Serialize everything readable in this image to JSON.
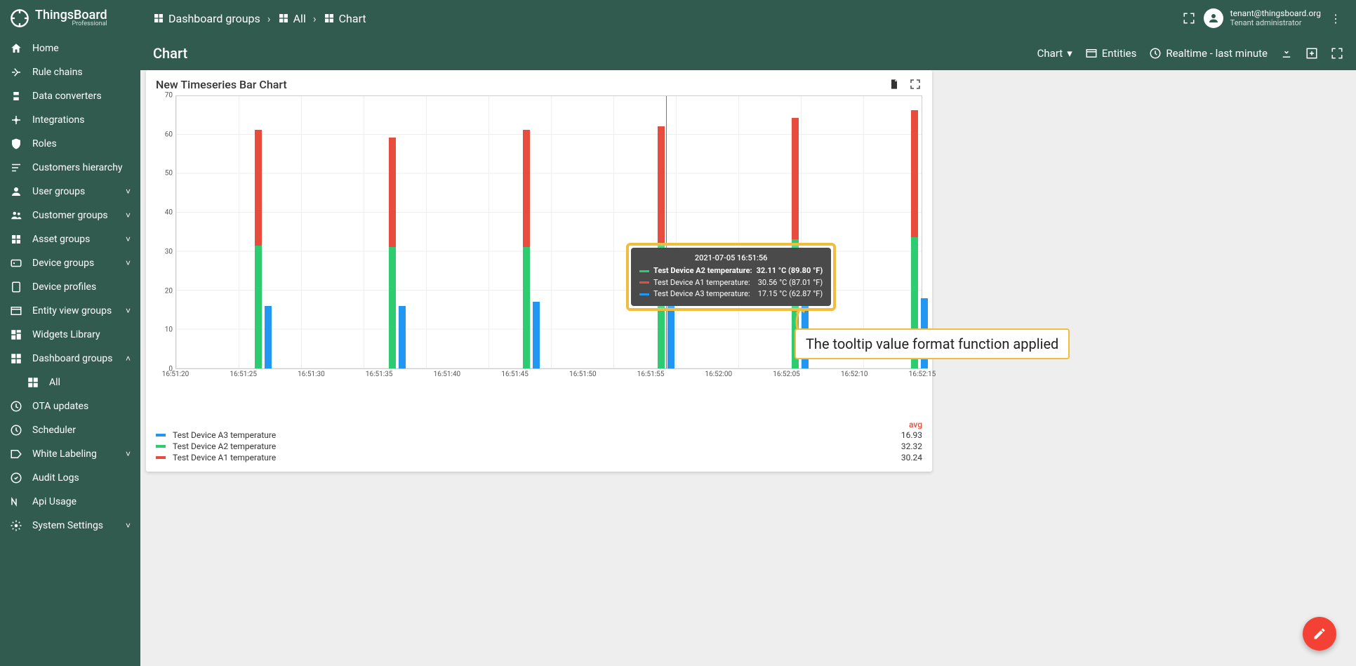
{
  "brand": {
    "name": "ThingsBoard",
    "edition": "Professional"
  },
  "user": {
    "email": "tenant@thingsboard.org",
    "role": "Tenant administrator"
  },
  "breadcrumbs": [
    {
      "label": "Dashboard groups"
    },
    {
      "label": "All"
    },
    {
      "label": "Chart"
    }
  ],
  "sidebar": [
    {
      "icon": "home",
      "label": "Home"
    },
    {
      "icon": "rules",
      "label": "Rule chains"
    },
    {
      "icon": "convert",
      "label": "Data converters"
    },
    {
      "icon": "integr",
      "label": "Integrations"
    },
    {
      "icon": "shield",
      "label": "Roles"
    },
    {
      "icon": "hier",
      "label": "Customers hierarchy"
    },
    {
      "icon": "user",
      "label": "User groups",
      "expand": "down"
    },
    {
      "icon": "cust",
      "label": "Customer groups",
      "expand": "down"
    },
    {
      "icon": "asset",
      "label": "Asset groups",
      "expand": "down"
    },
    {
      "icon": "device",
      "label": "Device groups",
      "expand": "down"
    },
    {
      "icon": "profile",
      "label": "Device profiles"
    },
    {
      "icon": "entity",
      "label": "Entity view groups",
      "expand": "down"
    },
    {
      "icon": "widget",
      "label": "Widgets Library"
    },
    {
      "icon": "dash",
      "label": "Dashboard groups",
      "expand": "up"
    },
    {
      "icon": "dash",
      "label": "All",
      "sub": true
    },
    {
      "icon": "ota",
      "label": "OTA updates"
    },
    {
      "icon": "sched",
      "label": "Scheduler"
    },
    {
      "icon": "label",
      "label": "White Labeling",
      "expand": "down"
    },
    {
      "icon": "audit",
      "label": "Audit Logs"
    },
    {
      "icon": "api",
      "label": "Api Usage"
    },
    {
      "icon": "settings",
      "label": "System Settings",
      "expand": "down"
    }
  ],
  "subbar": {
    "title": "Chart",
    "dashboard_dropdown": "Chart",
    "entities": "Entities",
    "time": "Realtime - last minute"
  },
  "card": {
    "title": "New Timeseries Bar Chart"
  },
  "colors": {
    "a1": "#E74C3C",
    "a2": "#2ECC71",
    "a3": "#2196F3",
    "highlight": "#F0BE3C"
  },
  "chart_data": {
    "type": "bar",
    "title": "New Timeseries Bar Chart",
    "ylim": [
      0,
      70
    ],
    "yticks": [
      0,
      10,
      20,
      30,
      40,
      50,
      60,
      70
    ],
    "x_ticks": [
      "16:51:20",
      "16:51:25",
      "16:51:30",
      "16:51:35",
      "16:51:40",
      "16:51:45",
      "16:51:50",
      "16:51:55",
      "16:52:00",
      "16:52:05",
      "16:52:10",
      "16:52:15"
    ],
    "categories": [
      "16:51:26",
      "16:51:36",
      "16:51:46",
      "16:51:56",
      "16:52:06",
      "16:52:16"
    ],
    "groups": [
      {
        "a1_top": 61,
        "a2_top": 31.5,
        "a3": 16,
        "xfrac": 0.115
      },
      {
        "a1_top": 59,
        "a2_top": 31,
        "a3": 16,
        "xfrac": 0.295
      },
      {
        "a1_top": 61,
        "a2_top": 31,
        "a3": 17,
        "xfrac": 0.475
      },
      {
        "a1_top": 62,
        "a2_top": 32.11,
        "a3": 16,
        "xfrac": 0.655
      },
      {
        "a1_top": 64,
        "a2_top": 33,
        "a3": 17,
        "xfrac": 0.835
      },
      {
        "a1_top": 66,
        "a2_top": 33.5,
        "a3": 18,
        "xfrac": 0.995
      }
    ],
    "crosshair_xfrac": 0.657,
    "series": [
      {
        "name": "Test Device A3 temperature",
        "color": "#2196F3",
        "avg": "16.93"
      },
      {
        "name": "Test Device A2 temperature",
        "color": "#2ECC71",
        "avg": "32.32"
      },
      {
        "name": "Test Device A1 temperature",
        "color": "#E74C3C",
        "avg": "30.24"
      }
    ],
    "avg_header": "avg"
  },
  "tooltip": {
    "time": "2021-07-05 16:51:56",
    "rows": [
      {
        "color": "#2ECC71",
        "label": "Test Device A2 temperature:",
        "value": "32.11 °C (89.80 °F)",
        "bold": true
      },
      {
        "color": "#E74C3C",
        "label": "Test Device A1 temperature:",
        "value": "30.56 °C (87.01 °F)"
      },
      {
        "color": "#2196F3",
        "label": "Test Device A3 temperature:",
        "value": "17.15 °C (62.87 °F)"
      }
    ]
  },
  "annotation": "The tooltip value format function applied"
}
